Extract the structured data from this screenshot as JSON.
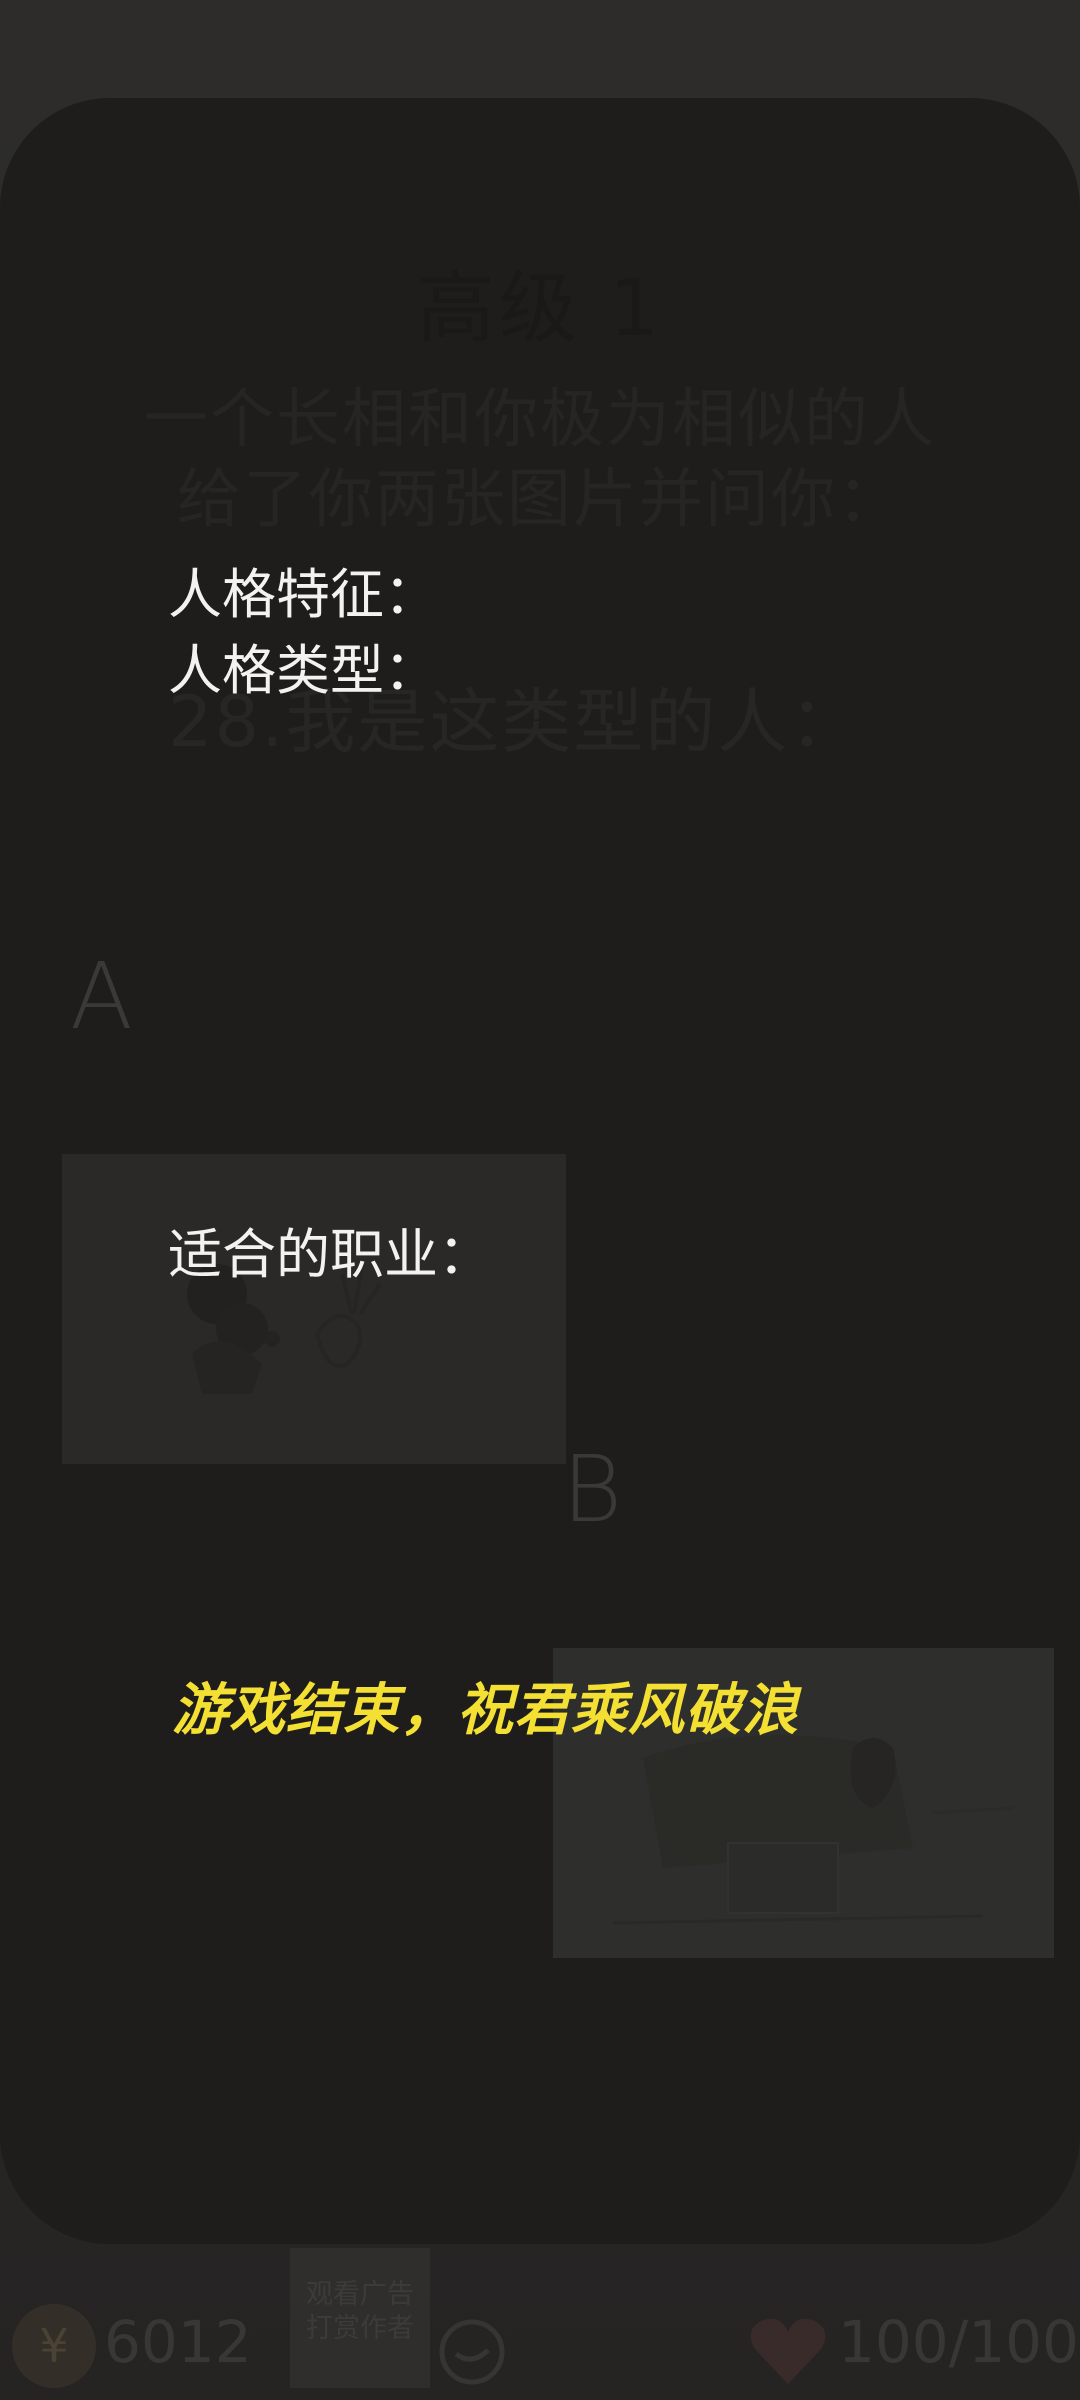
{
  "card": {
    "title": "高级 1",
    "story_lines": [
      "一个长相和你极为相似的人",
      "给了你两张图片并问你："
    ],
    "question": "28.我是这类型的人：",
    "option_a_letter": "A",
    "option_b_letter": "B"
  },
  "result": {
    "trait_label": "人格特征：",
    "type_label": "人格类型：",
    "career_label": "适合的职业：",
    "end_message": "游戏结束，祝君乘风破浪"
  },
  "bottom_bar": {
    "coin_icon": "yen-coin-icon",
    "coin_symbol": "¥",
    "coins": "6012",
    "ad_line1": "观看广告",
    "ad_line2": "打赏作者",
    "chat_icon": "chat-bubble-icon",
    "heart_icon": "heart-icon",
    "lives": "100/100"
  },
  "colors": {
    "end_message": "#f4e033",
    "overlay_text": "#f2f2f2",
    "background": "#1e1d1c"
  }
}
